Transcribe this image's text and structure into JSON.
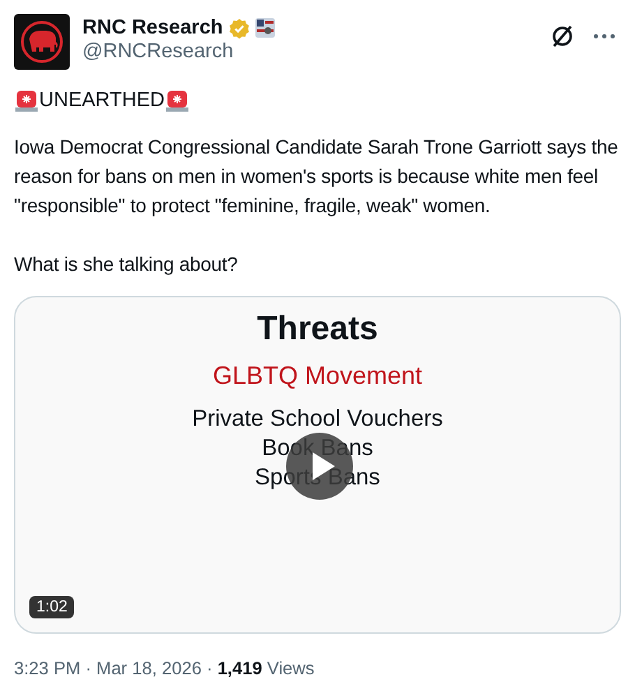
{
  "author": {
    "name": "RNC Research",
    "verified": true,
    "handle": "@RNCResearch"
  },
  "tweet": {
    "headline": "UNEARTHED",
    "body": "Iowa Democrat Congressional Candidate Sarah Trone Garriott says the reason for bans on men in women's sports is because white men feel \"responsible\" to protect \"feminine, fragile, weak\" women.",
    "question": "What is she talking about?"
  },
  "video": {
    "slide": {
      "title": "Threats",
      "subtitle": "GLBTQ Movement",
      "items": [
        "Private School Vouchers",
        "Book Bans",
        "Sports Bans"
      ]
    },
    "duration": "1:02"
  },
  "footer": {
    "meta": "3:23 PM · Mar 18, 2026 · **1,419** Views"
  }
}
